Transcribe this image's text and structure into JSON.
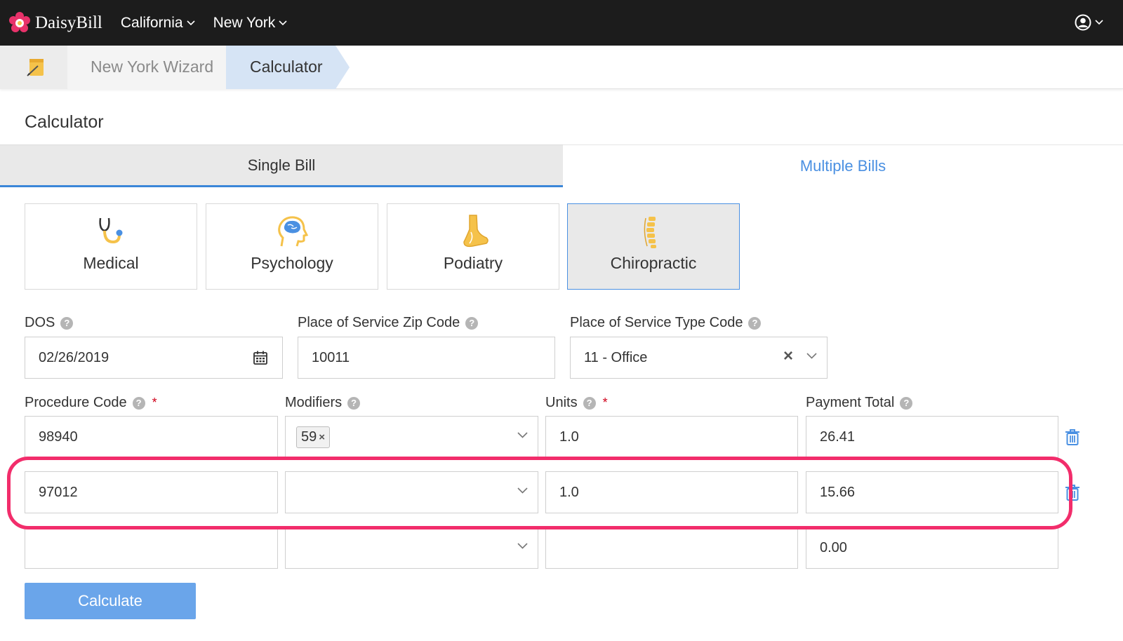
{
  "app": {
    "brand": "DaisyBill"
  },
  "nav": {
    "items": [
      {
        "label": "California"
      },
      {
        "label": "New York"
      }
    ]
  },
  "breadcrumb": {
    "items": [
      {
        "label": "New York Wizard"
      },
      {
        "label": "Calculator"
      }
    ]
  },
  "page": {
    "title": "Calculator"
  },
  "tabs": {
    "single": "Single Bill",
    "multiple": "Multiple Bills",
    "active": "single"
  },
  "specialties": {
    "items": [
      {
        "label": "Medical"
      },
      {
        "label": "Psychology"
      },
      {
        "label": "Podiatry"
      },
      {
        "label": "Chiropractic"
      }
    ],
    "selected": "Chiropractic"
  },
  "form": {
    "dos_label": "DOS",
    "dos_value": "02/26/2019",
    "zip_label": "Place of Service Zip Code",
    "zip_value": "10011",
    "type_label": "Place of Service Type Code",
    "type_value": "11 - Office",
    "procedure_label": "Procedure Code",
    "modifiers_label": "Modifiers",
    "units_label": "Units",
    "payment_label": "Payment Total",
    "required_marker": "*",
    "help_glyph": "?",
    "clear_glyph": "×",
    "rows": [
      {
        "procedure": "98940",
        "modifier": "59",
        "units": "1.0",
        "payment": "26.41"
      },
      {
        "procedure": "97012",
        "modifier": "",
        "units": "1.0",
        "payment": "15.66"
      },
      {
        "procedure": "",
        "modifier": "",
        "units": "",
        "payment": "0.00"
      }
    ],
    "highlighted_row": 1
  },
  "actions": {
    "calculate": "Calculate"
  },
  "colors": {
    "accent": "#4a90e2",
    "highlight": "#f22d6b",
    "topbar": "#1c1c1c",
    "button": "#6aa5ea"
  }
}
